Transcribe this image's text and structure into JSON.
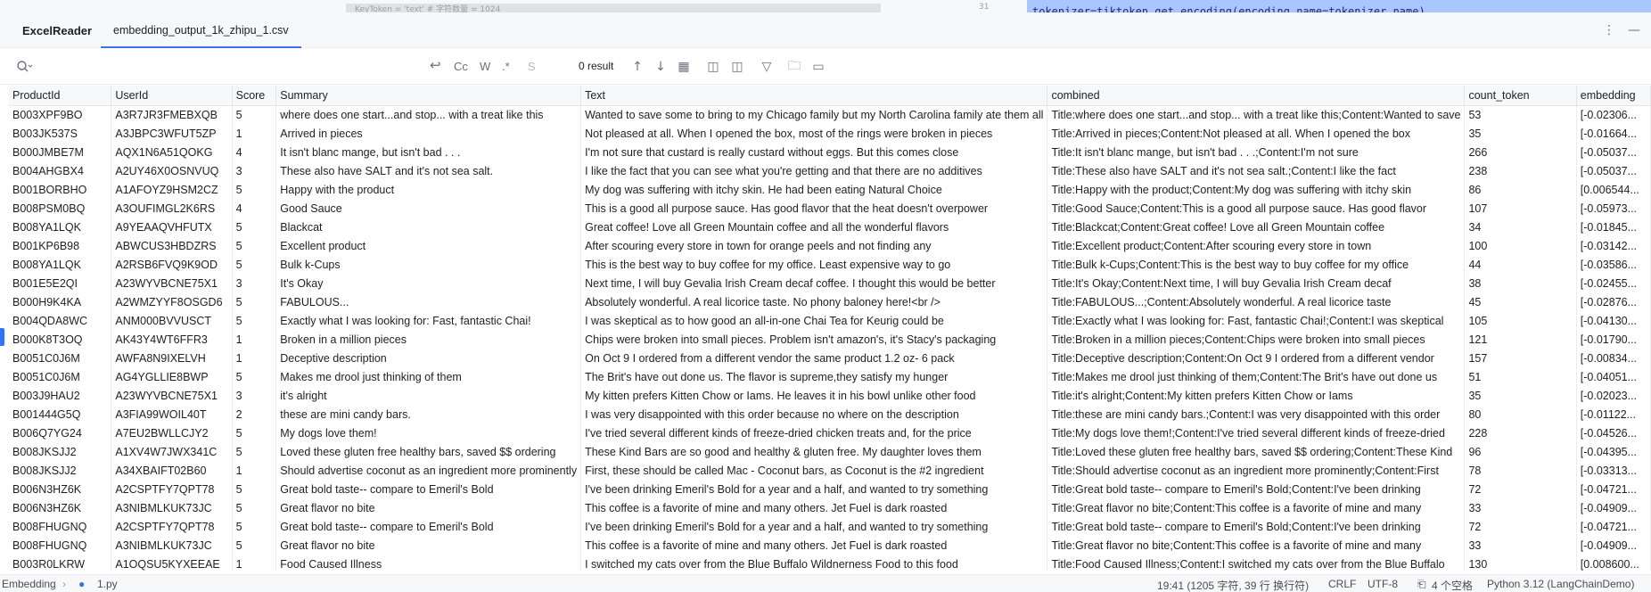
{
  "background": {
    "left_text": "KeyToken = 'text' # 字符数量 = 1024",
    "line_number": "31",
    "code_line": "tokenizer=tiktoken.get_encoding(encoding_name=tokenizer_name)"
  },
  "tool_window": {
    "title": "ExcelReader",
    "file_tab": "embedding_output_1k_zhipu_1.csv",
    "more_icon": "more-vertical-icon",
    "minimize_icon": "minimize-icon"
  },
  "search": {
    "placeholder": "",
    "value": "",
    "options": [
      "Cc",
      "W",
      ".*",
      "S"
    ],
    "result_count": "0 result"
  },
  "table": {
    "columns": [
      "ProductId",
      "UserId",
      "Score",
      "Summary",
      "Text",
      "combined",
      "count_token",
      "embedding"
    ],
    "rows": [
      [
        "B003XPF9BO",
        "A3R7JR3FMEBXQB",
        "5",
        "where does one  start...and stop... with a treat like this",
        "Wanted to save some to bring to my Chicago family but my North Carolina family ate them all",
        "Title:where does one  start...and stop... with a treat like this;Content:Wanted to save",
        "53",
        "[-0.02306..."
      ],
      [
        "B003JK537S",
        "A3JBPC3WFUT5ZP",
        "1",
        "Arrived in pieces",
        "Not pleased at all. When I opened the box, most of the rings were broken in pieces",
        "Title:Arrived in pieces;Content:Not pleased at all. When I opened the box",
        "35",
        "[-0.01664..."
      ],
      [
        "B000JMBE7M",
        "AQX1N6A51QOKG",
        "4",
        "It isn't blanc mange, but isn't bad . . .",
        "I'm not sure that custard is really custard without eggs.  But this comes close",
        "Title:It isn't blanc mange, but isn't bad . . .;Content:I'm not sure",
        "266",
        "[-0.05037..."
      ],
      [
        "B004AHGBX4",
        "A2UY46X0OSNVUQ",
        "3",
        "These also have SALT and it's not sea salt.",
        "I like the fact that you can see what you're getting and that there are no additives",
        "Title:These also have SALT and it's not sea salt.;Content:I like the fact",
        "238",
        "[-0.05037..."
      ],
      [
        "B001BORBHO",
        "A1AFOYZ9HSM2CZ",
        "5",
        "Happy with the product",
        "My dog was suffering with itchy skin.  He had been eating Natural Choice",
        "Title:Happy with the product;Content:My dog was suffering with itchy skin",
        "86",
        "[0.006544..."
      ],
      [
        "B008PSM0BQ",
        "A3OUFIMGL2K6RS",
        "4",
        "Good Sauce",
        "This is a good all purpose sauce.  Has good flavor that the heat doesn't overpower",
        "Title:Good Sauce;Content:This is a good all purpose sauce.  Has good flavor",
        "107",
        "[-0.05973..."
      ],
      [
        "B008YA1LQK",
        "A9YEAAQVHFUTX",
        "5",
        "Blackcat",
        "Great coffee!  Love all Green Mountain coffee and all the wonderful flavors",
        "Title:Blackcat;Content:Great coffee!  Love all Green Mountain coffee",
        "34",
        "[-0.01845..."
      ],
      [
        "B001KP6B98",
        "ABWCUS3HBDZRS",
        "5",
        "Excellent product",
        "After scouring every store in town for orange peels and not finding any",
        "Title:Excellent product;Content:After scouring every store in town",
        "100",
        "[-0.03142..."
      ],
      [
        "B008YA1LQK",
        "A2RSB6FVQ9K9OD",
        "5",
        "Bulk k-Cups",
        "This is the best way to buy coffee for my office. Least expensive way to go",
        "Title:Bulk k-Cups;Content:This is the best way to buy coffee for my office",
        "44",
        "[-0.03586..."
      ],
      [
        "B001E5E2QI",
        "A23WYVBCNE75X1",
        "3",
        "It's Okay",
        "Next time, I will buy Gevalia Irish Cream decaf coffee.  I thought this would be better",
        "Title:It's Okay;Content:Next time, I will buy Gevalia Irish Cream decaf",
        "38",
        "[-0.02455..."
      ],
      [
        "B000H9K4KA",
        "A2WMZYYF8OSGD6",
        "5",
        "FABULOUS...",
        "Absolutely wonderful.  A real licorice taste.  No phony baloney here!<br />",
        "Title:FABULOUS...;Content:Absolutely wonderful.  A real licorice taste",
        "45",
        "[-0.02876..."
      ],
      [
        "B004QDA8WC",
        "ANM000BVVUSCT",
        "5",
        "Exactly what I was looking for: Fast, fantastic Chai!",
        "I was skeptical as to how good an all-in-one Chai Tea for Keurig could be",
        "Title:Exactly what I was looking for: Fast, fantastic Chai!;Content:I was skeptical",
        "105",
        "[-0.04130..."
      ],
      [
        "B000K8T3OQ",
        "AK43Y4WT6FFR3",
        "1",
        "Broken in a million pieces",
        "Chips were broken into small pieces. Problem isn't amazon's, it's Stacy's packaging",
        "Title:Broken in a million pieces;Content:Chips were broken into small pieces",
        "121",
        "[-0.01790..."
      ],
      [
        "B0051C0J6M",
        "AWFA8N9IXELVH",
        "1",
        "Deceptive description",
        "On Oct 9 I ordered from a different vendor the same product 1.2 oz- 6 pack",
        "Title:Deceptive description;Content:On Oct 9 I ordered from a different vendor",
        "157",
        "[-0.00834..."
      ],
      [
        "B0051C0J6M",
        "AG4YGLLIE8BWP",
        "5",
        "Makes me drool just thinking of them",
        "The Brit's have out done us. The flavor is supreme,they satisfy my hunger",
        "Title:Makes me drool just thinking of them;Content:The Brit's have out done us",
        "51",
        "[-0.04051..."
      ],
      [
        "B003J9HAU2",
        "A23WYVBCNE75X1",
        "3",
        "it's alright",
        "My kitten prefers Kitten Chow or Iams.  He leaves it in his bowl unlike other food",
        "Title:it's alright;Content:My kitten prefers Kitten Chow or Iams",
        "35",
        "[-0.02023..."
      ],
      [
        "B001444G5Q",
        "A3FIA99WOIL40T",
        "2",
        "these are mini candy bars.",
        "I was very disappointed with this order because no where on the description",
        "Title:these are mini candy bars.;Content:I was very disappointed with this order",
        "80",
        "[-0.01122..."
      ],
      [
        "B006Q7YG24",
        "A7EU2BWLLCJY2",
        "5",
        "My dogs love them!",
        "I've tried several different kinds of freeze-dried chicken treats and, for the price",
        "Title:My dogs love them!;Content:I've tried several different kinds of freeze-dried",
        "228",
        "[-0.04526..."
      ],
      [
        "B008JKSJJ2",
        "A1XV4W7JWX341C",
        "5",
        "Loved these gluten free healthy bars, saved $$ ordering",
        "These Kind Bars are so good and healthy & gluten free.  My daughter loves them",
        "Title:Loved these gluten free healthy bars, saved $$ ordering;Content:These Kind",
        "96",
        "[-0.04395..."
      ],
      [
        "B008JKSJJ2",
        "A34XBAIFT02B60",
        "1",
        "Should advertise coconut as an ingredient more prominently",
        "First, these should be called Mac - Coconut bars, as Coconut is the #2 ingredient",
        "Title:Should advertise coconut as an ingredient more prominently;Content:First",
        "78",
        "[-0.03313..."
      ],
      [
        "B006N3HZ6K",
        "A2CSPTFY7QPT78",
        "5",
        "Great bold taste-- compare to Emeril's Bold",
        "I've been drinking Emeril's Bold for a year and a half, and wanted to try something",
        "Title:Great bold taste-- compare to Emeril's Bold;Content:I've been drinking",
        "72",
        "[-0.04721..."
      ],
      [
        "B006N3HZ6K",
        "A3NIBMLKUK73JC",
        "5",
        "Great flavor no bite",
        "This coffee is a favorite of mine and many others. Jet Fuel is dark roasted",
        "Title:Great flavor no bite;Content:This coffee is a favorite of mine and many",
        "33",
        "[-0.04909..."
      ],
      [
        "B008FHUGNQ",
        "A2CSPTFY7QPT78",
        "5",
        "Great bold taste-- compare to Emeril's Bold",
        "I've been drinking Emeril's Bold for a year and a half, and wanted to try something",
        "Title:Great bold taste-- compare to Emeril's Bold;Content:I've been drinking",
        "72",
        "[-0.04721..."
      ],
      [
        "B008FHUGNQ",
        "A3NIBMLKUK73JC",
        "5",
        "Great flavor no bite",
        "This coffee is a favorite of mine and many others. Jet Fuel is dark roasted",
        "Title:Great flavor no bite;Content:This coffee is a favorite of mine and many",
        "33",
        "[-0.04909..."
      ],
      [
        "B003R0LKRW",
        "A1OQSU5KYXEEAE",
        "1",
        "Food Caused Illness",
        "I switched my cats over from the Blue Buffalo Wildnerness Food to this food",
        "Title:Food Caused Illness;Content:I switched my cats over from the Blue Buffalo",
        "130",
        "[0.008600..."
      ]
    ]
  },
  "status_bar": {
    "breadcrumb_root": "Embedding",
    "breadcrumb_file": "1.py",
    "position": "19:41 (1205 字符, 39 行 换行符)",
    "line_ending": "CRLF",
    "encoding": "UTF-8",
    "indent": "4 个空格",
    "interpreter": "Python 3.12 (LangChainDemo)"
  },
  "colors": {
    "accent": "#3574f0",
    "header_bg": "#f7f8fa",
    "selection": "#a9c6ff"
  }
}
